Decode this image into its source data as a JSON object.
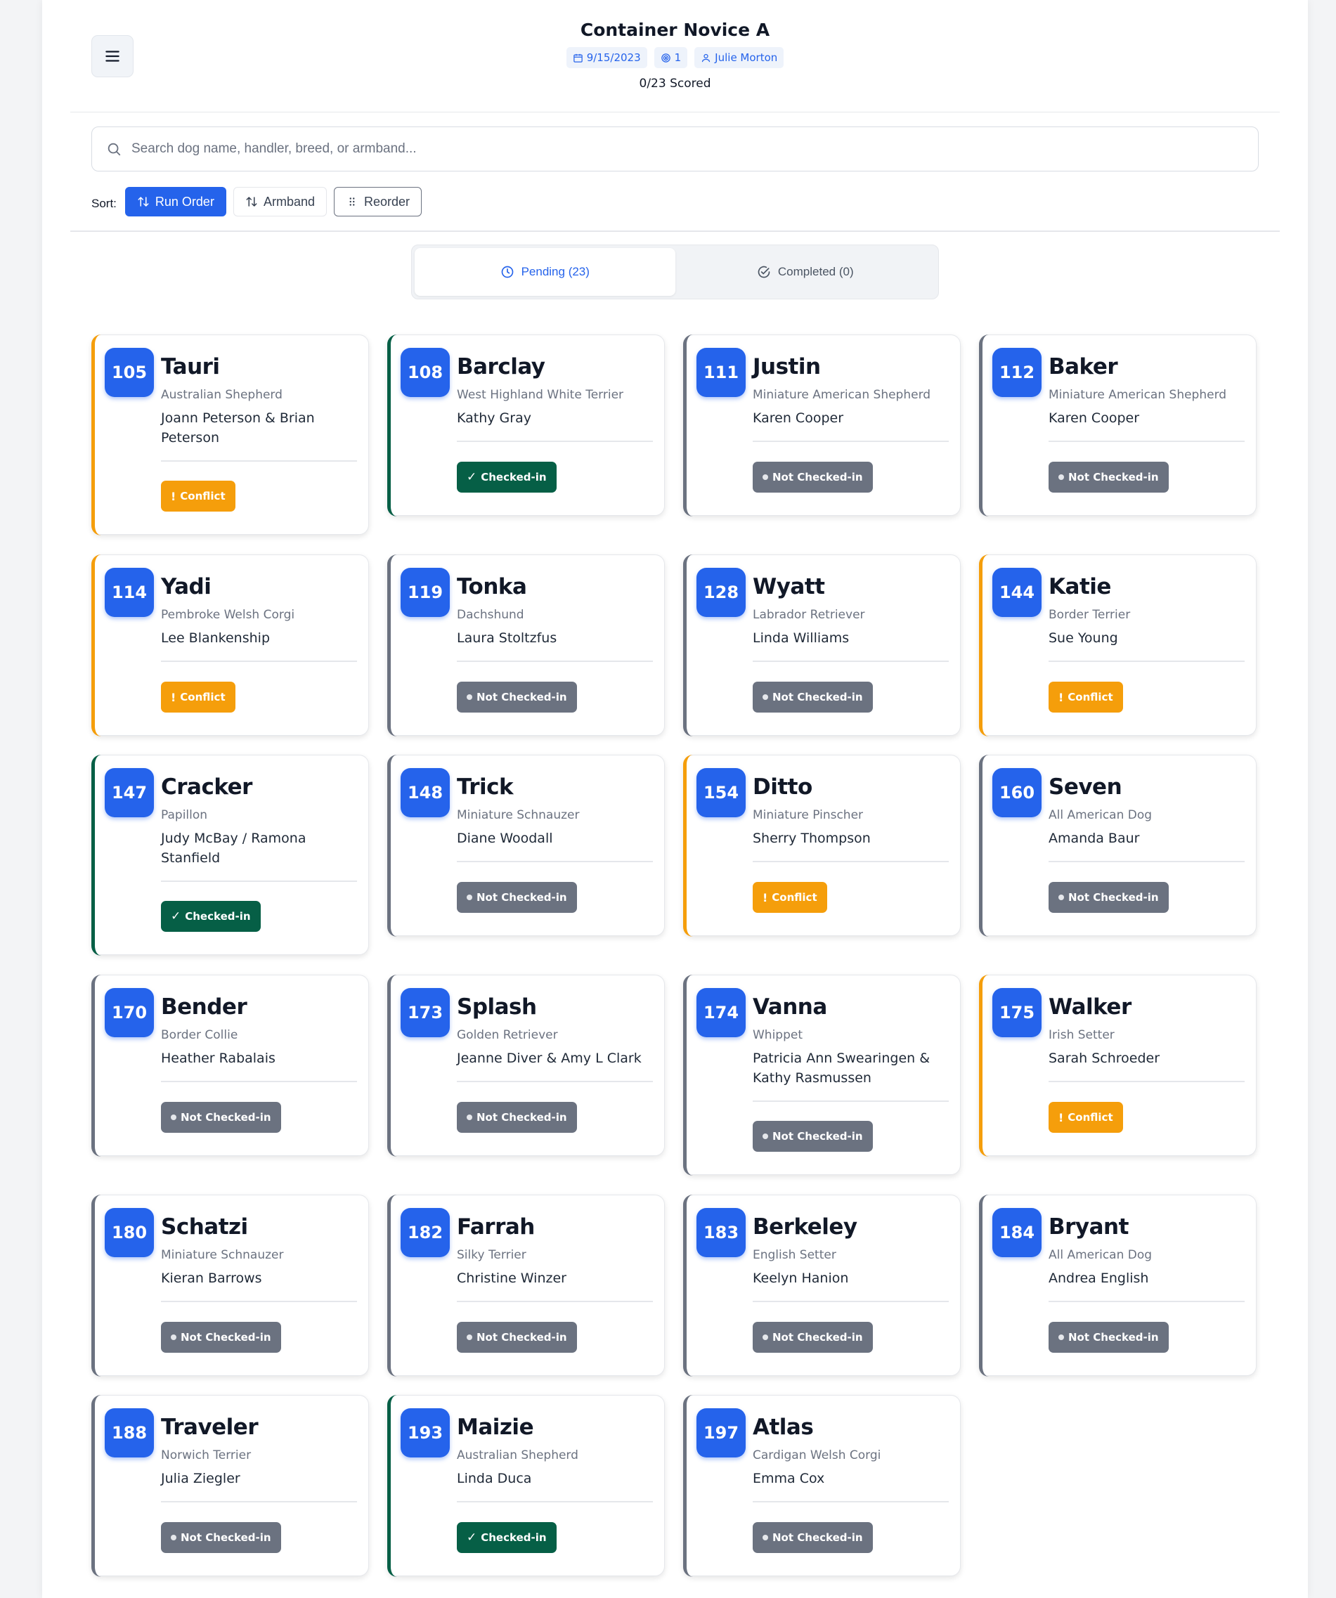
{
  "header": {
    "title": "Container Novice A",
    "date": "9/15/2023",
    "level": "1",
    "judge": "Julie Morton",
    "scored": "0/23 Scored"
  },
  "search": {
    "placeholder": "Search dog name, handler, breed, or armband..."
  },
  "sort": {
    "label": "Sort:",
    "run_order": "Run Order",
    "armband": "Armband",
    "reorder": "Reorder"
  },
  "tabs": {
    "pending": "Pending (23)",
    "completed": "Completed (0)"
  },
  "status_labels": {
    "not": "Not Checked-in",
    "conflict": "Conflict",
    "checked": "Checked-in"
  },
  "colors": {
    "accent": "#2563eb",
    "conflict": "#f59e0b",
    "checked": "#065f46",
    "not_checked": "#6b7280"
  },
  "cards": [
    {
      "armband": "105",
      "name": "Tauri",
      "breed": "Australian Shepherd",
      "handler": "Joann Peterson & Brian Peterson",
      "status": "conflict"
    },
    {
      "armband": "108",
      "name": "Barclay",
      "breed": "West Highland White Terrier",
      "handler": "Kathy Gray",
      "status": "checked"
    },
    {
      "armband": "111",
      "name": "Justin",
      "breed": "Miniature American Shepherd",
      "handler": "Karen Cooper",
      "status": "not"
    },
    {
      "armband": "112",
      "name": "Baker",
      "breed": "Miniature American Shepherd",
      "handler": "Karen Cooper",
      "status": "not"
    },
    {
      "armband": "114",
      "name": "Yadi",
      "breed": "Pembroke Welsh Corgi",
      "handler": "Lee Blankenship",
      "status": "conflict"
    },
    {
      "armband": "119",
      "name": "Tonka",
      "breed": "Dachshund",
      "handler": "Laura Stoltzfus",
      "status": "not"
    },
    {
      "armband": "128",
      "name": "Wyatt",
      "breed": "Labrador Retriever",
      "handler": "Linda Williams",
      "status": "not"
    },
    {
      "armband": "144",
      "name": "Katie",
      "breed": "Border Terrier",
      "handler": "Sue Young",
      "status": "conflict"
    },
    {
      "armband": "147",
      "name": "Cracker",
      "breed": "Papillon",
      "handler": "Judy McBay / Ramona Stanfield",
      "status": "checked"
    },
    {
      "armband": "148",
      "name": "Trick",
      "breed": "Miniature Schnauzer",
      "handler": "Diane Woodall",
      "status": "not"
    },
    {
      "armband": "154",
      "name": "Ditto",
      "breed": "Miniature Pinscher",
      "handler": "Sherry Thompson",
      "status": "conflict"
    },
    {
      "armband": "160",
      "name": "Seven",
      "breed": "All American Dog",
      "handler": "Amanda Baur",
      "status": "not"
    },
    {
      "armband": "170",
      "name": "Bender",
      "breed": "Border Collie",
      "handler": "Heather Rabalais",
      "status": "not"
    },
    {
      "armband": "173",
      "name": "Splash",
      "breed": "Golden Retriever",
      "handler": "Jeanne Diver & Amy L Clark",
      "status": "not"
    },
    {
      "armband": "174",
      "name": "Vanna",
      "breed": "Whippet",
      "handler": "Patricia Ann Swearingen & Kathy Rasmussen",
      "status": "not"
    },
    {
      "armband": "175",
      "name": "Walker",
      "breed": "Irish Setter",
      "handler": "Sarah Schroeder",
      "status": "conflict"
    },
    {
      "armband": "180",
      "name": "Schatzi",
      "breed": "Miniature Schnauzer",
      "handler": "Kieran Barrows",
      "status": "not"
    },
    {
      "armband": "182",
      "name": "Farrah",
      "breed": "Silky Terrier",
      "handler": "Christine Winzer",
      "status": "not"
    },
    {
      "armband": "183",
      "name": "Berkeley",
      "breed": "English Setter",
      "handler": "Keelyn Hanion",
      "status": "not"
    },
    {
      "armband": "184",
      "name": "Bryant",
      "breed": "All American Dog",
      "handler": "Andrea English",
      "status": "not"
    },
    {
      "armband": "188",
      "name": "Traveler",
      "breed": "Norwich Terrier",
      "handler": "Julia Ziegler",
      "status": "not"
    },
    {
      "armband": "193",
      "name": "Maizie",
      "breed": "Australian Shepherd",
      "handler": "Linda Duca",
      "status": "checked"
    },
    {
      "armband": "197",
      "name": "Atlas",
      "breed": "Cardigan Welsh Corgi",
      "handler": "Emma Cox",
      "status": "not"
    }
  ]
}
